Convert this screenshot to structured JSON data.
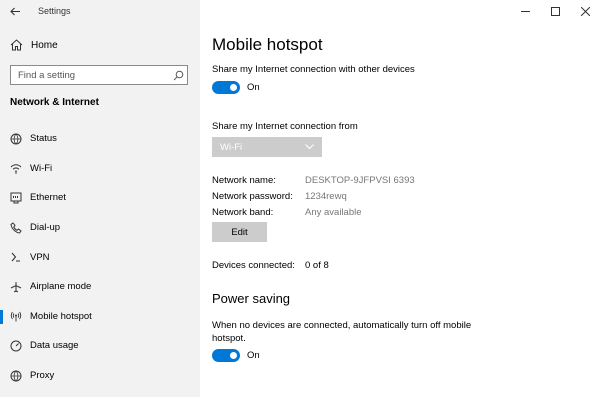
{
  "window": {
    "title": "Settings"
  },
  "sidebar": {
    "home_label": "Home",
    "search_placeholder": "Find a setting",
    "section_title": "Network & Internet",
    "items": [
      {
        "label": "Status",
        "icon": "globe-icon"
      },
      {
        "label": "Wi-Fi",
        "icon": "wifi-icon"
      },
      {
        "label": "Ethernet",
        "icon": "ethernet-icon"
      },
      {
        "label": "Dial-up",
        "icon": "phone-icon"
      },
      {
        "label": "VPN",
        "icon": "vpn-icon"
      },
      {
        "label": "Airplane mode",
        "icon": "airplane-icon"
      },
      {
        "label": "Mobile hotspot",
        "icon": "hotspot-icon",
        "active": true
      },
      {
        "label": "Data usage",
        "icon": "gauge-icon"
      },
      {
        "label": "Proxy",
        "icon": "globe-icon"
      }
    ]
  },
  "main": {
    "title": "Mobile hotspot",
    "share_label": "Share my Internet connection with other devices",
    "share_state": "On",
    "from_label": "Share my Internet connection from",
    "from_value": "Wi-Fi",
    "network_name_key": "Network name:",
    "network_name_val": "DESKTOP-9JFPVSI 6393",
    "network_password_key": "Network password:",
    "network_password_val": "1234rewq",
    "network_band_key": "Network band:",
    "network_band_val": "Any available",
    "edit_label": "Edit",
    "devices_key": "Devices connected:",
    "devices_val": "0 of 8",
    "power_saving_title": "Power saving",
    "power_saving_desc": "When no devices are connected, automatically turn off mobile hotspot.",
    "power_saving_state": "On"
  },
  "colors": {
    "accent": "#0078d7",
    "sidebar_bg": "#f2f2f2",
    "button_bg": "#cccccc"
  }
}
